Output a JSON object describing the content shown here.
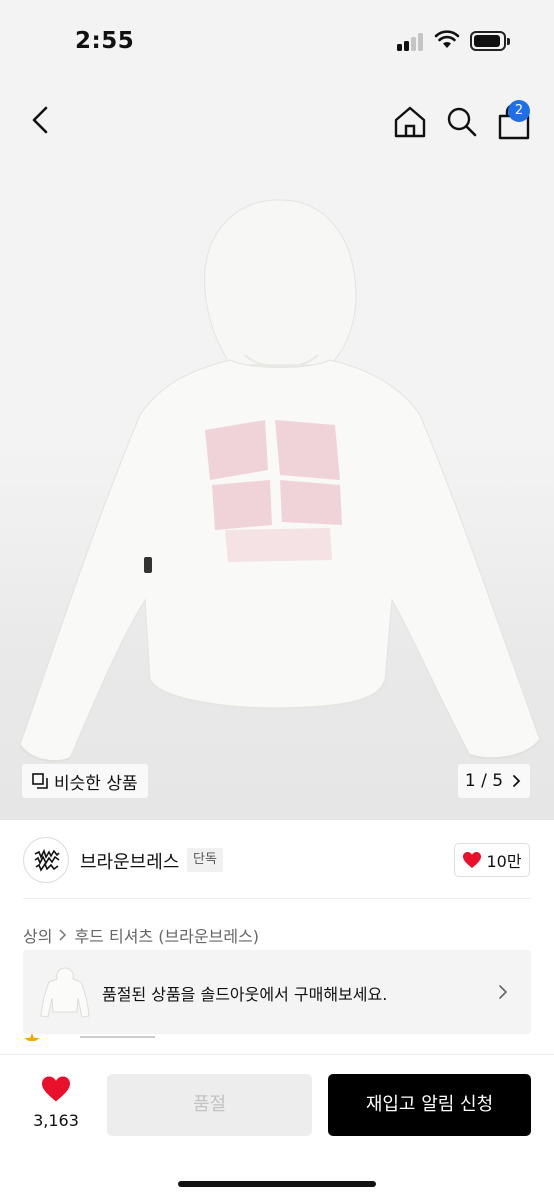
{
  "status_bar": {
    "time": "2:55"
  },
  "nav": {
    "cart_count": "2"
  },
  "hero": {
    "similar_label": "비슷한 상품",
    "pager": "1 / 5"
  },
  "brand": {
    "name": "브라운브레스",
    "badge": "단독",
    "likes": "10만"
  },
  "breadcrumb": {
    "category": "상의",
    "subcategory": "후드 티셔츠 (브라운브레스)"
  },
  "soldout_banner": {
    "text": "품절된 상품을 솔드아웃에서 구매해보세요."
  },
  "bottom_bar": {
    "wish_count": "3,163",
    "soldout_label": "품절",
    "restock_label": "재입고 알림 신청"
  },
  "colors": {
    "accent_badge": "#1f6feb",
    "heart": "#e8102a",
    "primary_button": "#000000"
  },
  "icons": [
    "back-icon",
    "home-icon",
    "search-icon",
    "cart-icon",
    "similar-products-icon",
    "chevron-right-icon",
    "heart-icon"
  ]
}
